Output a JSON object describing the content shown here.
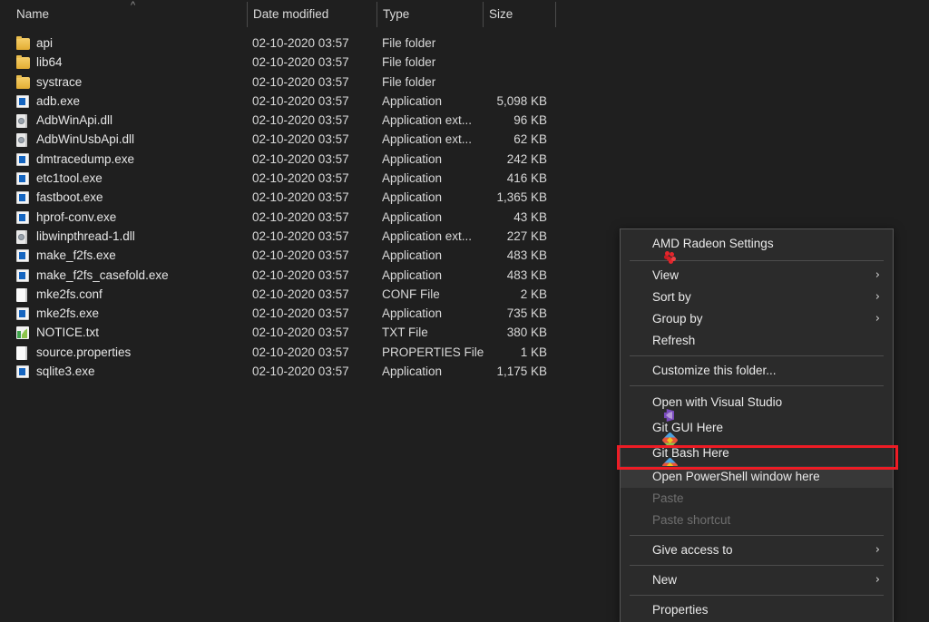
{
  "window": {
    "background_color": "#1f1f1f",
    "accent_color": "#ee1c25"
  },
  "columns": {
    "sort_indicator": "^",
    "headers": [
      {
        "label": "Name"
      },
      {
        "label": "Date modified"
      },
      {
        "label": "Type"
      },
      {
        "label": "Size"
      }
    ]
  },
  "files": [
    {
      "name": "api",
      "date": "02-10-2020 03:57",
      "type": "File folder",
      "size": "",
      "icon": "folder-icon"
    },
    {
      "name": "lib64",
      "date": "02-10-2020 03:57",
      "type": "File folder",
      "size": "",
      "icon": "folder-icon"
    },
    {
      "name": "systrace",
      "date": "02-10-2020 03:57",
      "type": "File folder",
      "size": "",
      "icon": "folder-icon"
    },
    {
      "name": "adb.exe",
      "date": "02-10-2020 03:57",
      "type": "Application",
      "size": "5,098 KB",
      "icon": "application-icon"
    },
    {
      "name": "AdbWinApi.dll",
      "date": "02-10-2020 03:57",
      "type": "Application ext...",
      "size": "96 KB",
      "icon": "dll-icon"
    },
    {
      "name": "AdbWinUsbApi.dll",
      "date": "02-10-2020 03:57",
      "type": "Application ext...",
      "size": "62 KB",
      "icon": "dll-icon"
    },
    {
      "name": "dmtracedump.exe",
      "date": "02-10-2020 03:57",
      "type": "Application",
      "size": "242 KB",
      "icon": "application-icon"
    },
    {
      "name": "etc1tool.exe",
      "date": "02-10-2020 03:57",
      "type": "Application",
      "size": "416 KB",
      "icon": "application-icon"
    },
    {
      "name": "fastboot.exe",
      "date": "02-10-2020 03:57",
      "type": "Application",
      "size": "1,365 KB",
      "icon": "application-icon"
    },
    {
      "name": "hprof-conv.exe",
      "date": "02-10-2020 03:57",
      "type": "Application",
      "size": "43 KB",
      "icon": "application-icon"
    },
    {
      "name": "libwinpthread-1.dll",
      "date": "02-10-2020 03:57",
      "type": "Application ext...",
      "size": "227 KB",
      "icon": "dll-icon"
    },
    {
      "name": "make_f2fs.exe",
      "date": "02-10-2020 03:57",
      "type": "Application",
      "size": "483 KB",
      "icon": "application-icon"
    },
    {
      "name": "make_f2fs_casefold.exe",
      "date": "02-10-2020 03:57",
      "type": "Application",
      "size": "483 KB",
      "icon": "application-icon"
    },
    {
      "name": "mke2fs.conf",
      "date": "02-10-2020 03:57",
      "type": "CONF File",
      "size": "2 KB",
      "icon": "document-icon"
    },
    {
      "name": "mke2fs.exe",
      "date": "02-10-2020 03:57",
      "type": "Application",
      "size": "735 KB",
      "icon": "application-icon"
    },
    {
      "name": "NOTICE.txt",
      "date": "02-10-2020 03:57",
      "type": "TXT File",
      "size": "380 KB",
      "icon": "text-file-icon"
    },
    {
      "name": "source.properties",
      "date": "02-10-2020 03:57",
      "type": "PROPERTIES File",
      "size": "1 KB",
      "icon": "document-icon"
    },
    {
      "name": "sqlite3.exe",
      "date": "02-10-2020 03:57",
      "type": "Application",
      "size": "1,175 KB",
      "icon": "application-icon"
    }
  ],
  "context_menu": {
    "items": [
      {
        "label": "AMD Radeon Settings",
        "icon": "amd-radeon-icon",
        "submenu": false,
        "disabled": false,
        "highlighted": false,
        "separator_after": true
      },
      {
        "label": "View",
        "icon": null,
        "submenu": true,
        "disabled": false,
        "highlighted": false,
        "separator_after": false
      },
      {
        "label": "Sort by",
        "icon": null,
        "submenu": true,
        "disabled": false,
        "highlighted": false,
        "separator_after": false
      },
      {
        "label": "Group by",
        "icon": null,
        "submenu": true,
        "disabled": false,
        "highlighted": false,
        "separator_after": false
      },
      {
        "label": "Refresh",
        "icon": null,
        "submenu": false,
        "disabled": false,
        "highlighted": false,
        "separator_after": true
      },
      {
        "label": "Customize this folder...",
        "icon": null,
        "submenu": false,
        "disabled": false,
        "highlighted": false,
        "separator_after": true
      },
      {
        "label": "Open with Visual Studio",
        "icon": "visual-studio-icon",
        "submenu": false,
        "disabled": false,
        "highlighted": false,
        "separator_after": false
      },
      {
        "label": "Git GUI Here",
        "icon": "git-icon",
        "submenu": false,
        "disabled": false,
        "highlighted": false,
        "separator_after": false
      },
      {
        "label": "Git Bash Here",
        "icon": "git-icon",
        "submenu": false,
        "disabled": false,
        "highlighted": false,
        "separator_after": false
      },
      {
        "label": "Open PowerShell window here",
        "icon": null,
        "submenu": false,
        "disabled": false,
        "highlighted": true,
        "separator_after": false
      },
      {
        "label": "Paste",
        "icon": null,
        "submenu": false,
        "disabled": true,
        "highlighted": false,
        "separator_after": false
      },
      {
        "label": "Paste shortcut",
        "icon": null,
        "submenu": false,
        "disabled": true,
        "highlighted": false,
        "separator_after": true
      },
      {
        "label": "Give access to",
        "icon": null,
        "submenu": true,
        "disabled": false,
        "highlighted": false,
        "separator_after": true
      },
      {
        "label": "New",
        "icon": null,
        "submenu": true,
        "disabled": false,
        "highlighted": false,
        "separator_after": true
      },
      {
        "label": "Properties",
        "icon": null,
        "submenu": false,
        "disabled": false,
        "highlighted": false,
        "separator_after": false
      }
    ],
    "submenu_arrow": "›"
  },
  "annotation": {
    "target_label": "Open PowerShell window here",
    "color": "#ee1c25"
  }
}
